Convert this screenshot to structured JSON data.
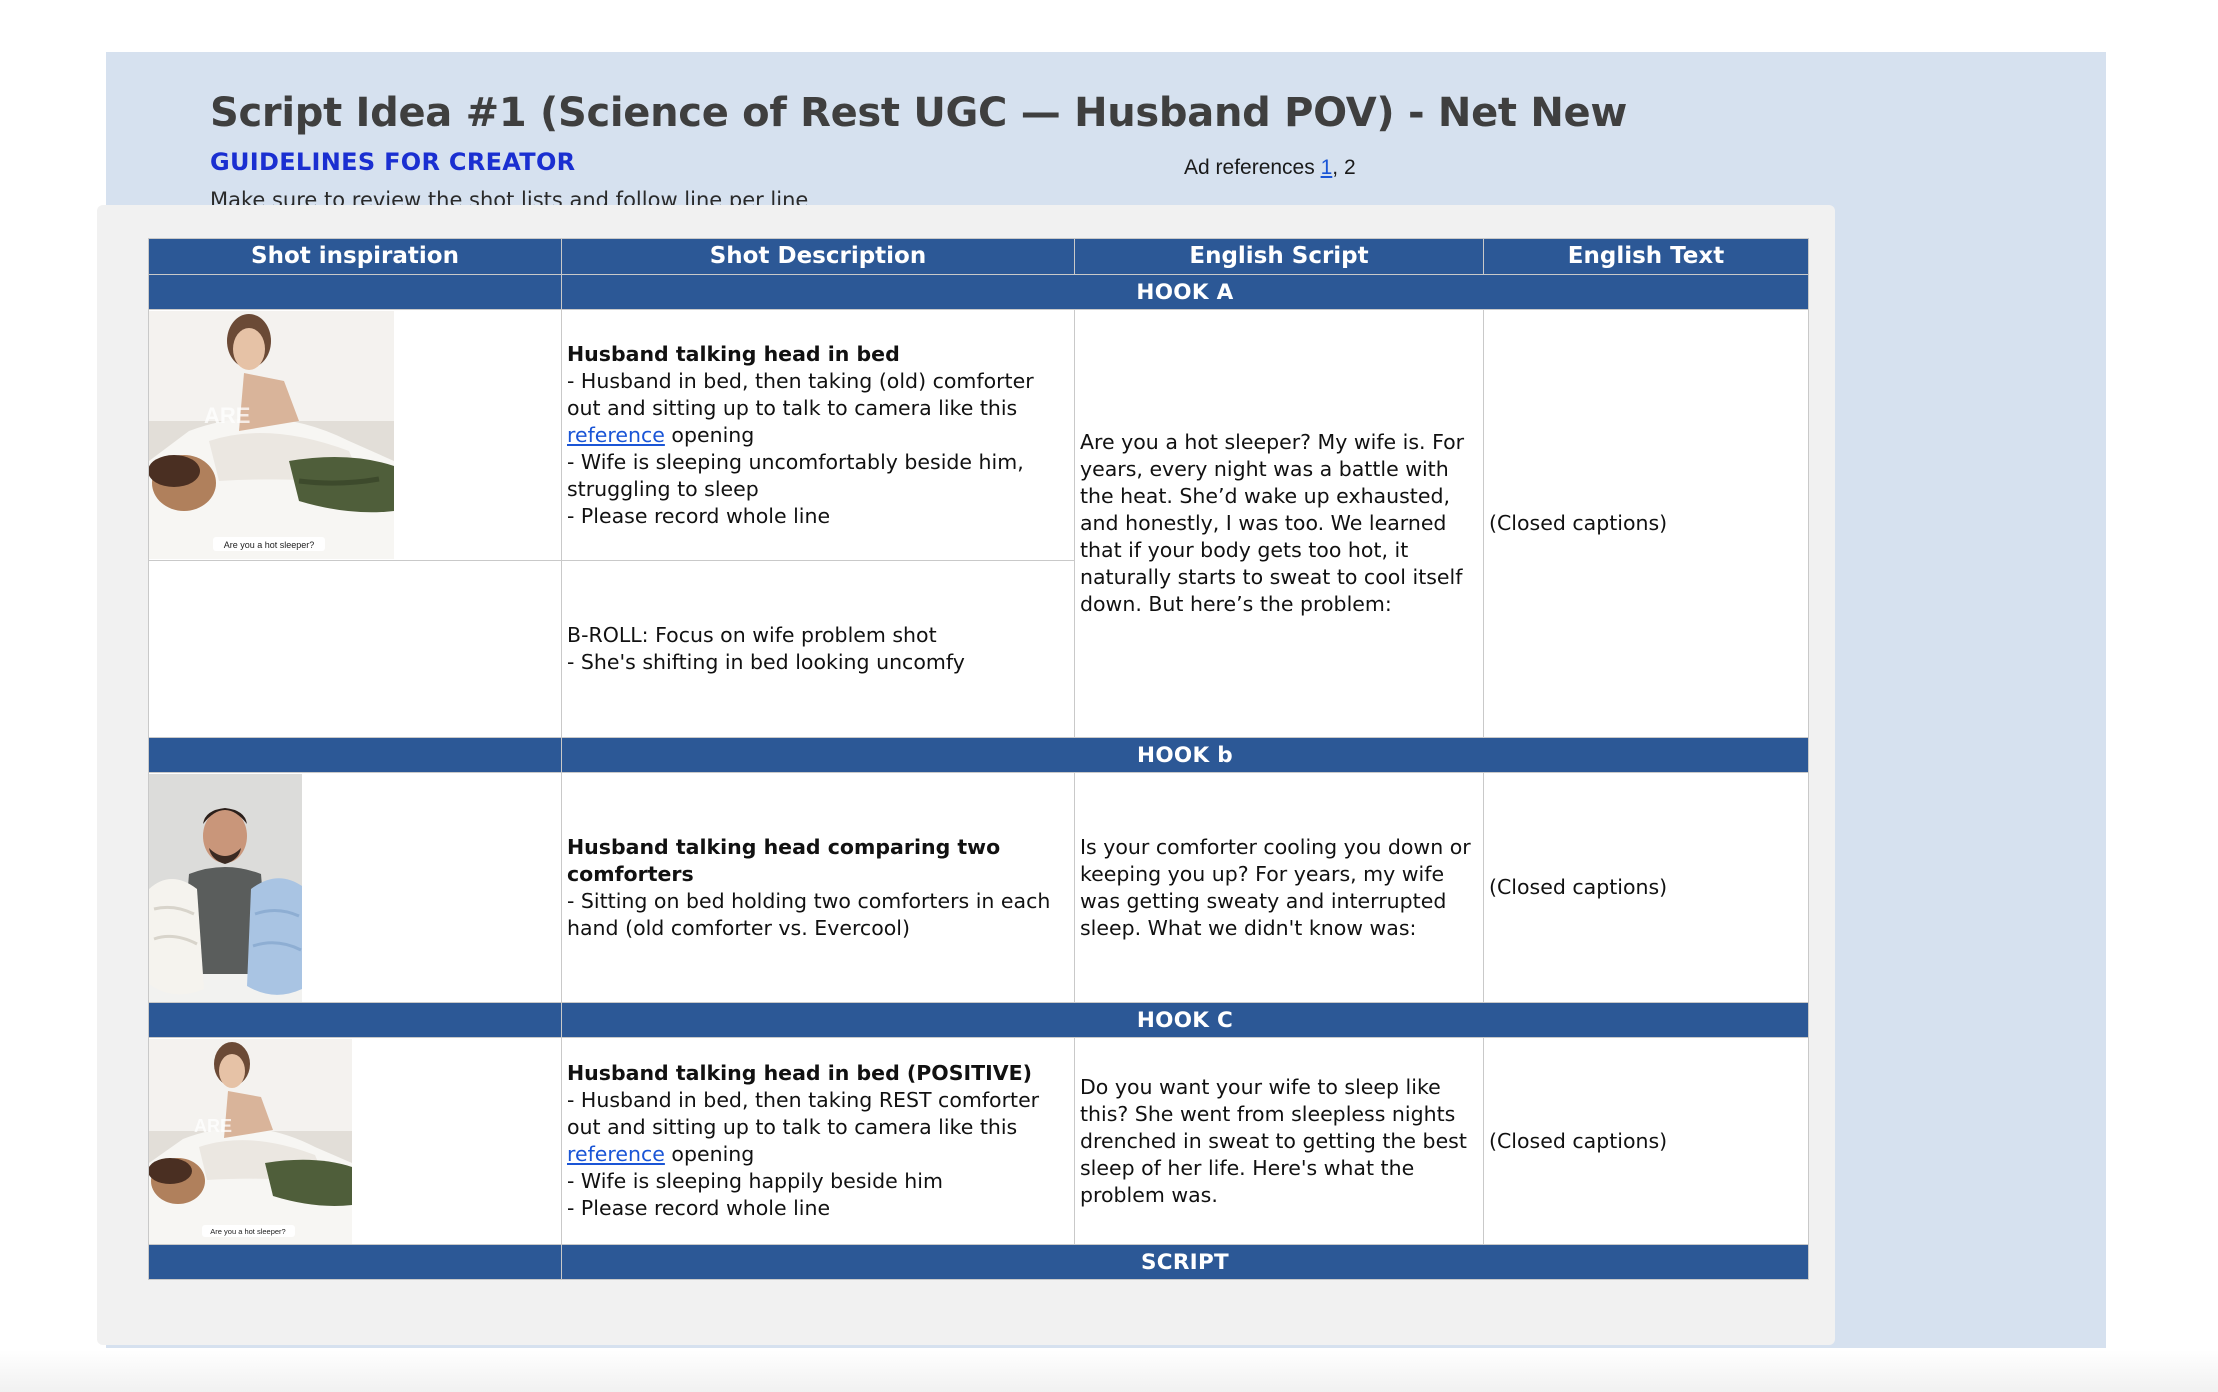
{
  "header": {
    "title": "Script Idea #1 (Science of Rest UGC — Husband POV) - Net New",
    "guidelines": "GUIDELINES FOR CREATOR",
    "instruction": "Make sure to review the shot lists and follow line per line",
    "ad_references_label": "Ad references",
    "ad_ref_1": "1",
    "ad_ref_sep": ", ",
    "ad_ref_2": "2"
  },
  "table": {
    "columns": [
      "Shot inspiration",
      "Shot Description",
      "English Script",
      "English Text"
    ],
    "sections": {
      "hook_a": {
        "title": "HOOK A",
        "thumb_word": "ARE",
        "thumb_caption": "Are you a hot sleeper?",
        "shot1_title": "Husband talking head in bed",
        "shot1_line1": "- Husband in bed, then taking (old) comforter out and sitting up to talk to camera like this",
        "shot1_link": "reference",
        "shot1_link_after": " opening",
        "shot1_line2": "- Wife is sleeping uncomfortably beside him, struggling to sleep",
        "shot1_line3": "- Please record whole line",
        "shot2_line1": "B-ROLL: Focus on wife problem shot",
        "shot2_line2": "- She's shifting in bed looking uncomfy",
        "script": "Are you a hot sleeper? My wife is. For years, every night was a battle with the heat. She’d wake up exhausted, and honestly, I was too. We learned that if your body gets too hot, it naturally starts to sweat to cool itself down. But here’s the problem:",
        "text": "(Closed captions)"
      },
      "hook_b": {
        "title": "HOOK b",
        "shot_title": "Husband talking head comparing two comforters",
        "shot_line1": "- Sitting on bed holding two comforters in each hand (old comforter vs. Evercool)",
        "script": "Is your comforter cooling you down or keeping you up? For years, my wife was getting sweaty and interrupted sleep. What we didn't know was:",
        "text": "(Closed captions)"
      },
      "hook_c": {
        "title": "HOOK C",
        "thumb_word": "ARE",
        "thumb_caption": "Are you a hot sleeper?",
        "shot_title": "Husband talking head in bed (POSITIVE)",
        "shot_line1": "- Husband in bed, then taking REST comforter out and sitting up to talk to camera like this",
        "shot_link": "reference",
        "shot_link_after": " opening",
        "shot_line2": "- Wife is sleeping happily beside him",
        "shot_line3": "- Please record whole line",
        "script": "Do you want your wife to sleep like this? She went from sleepless nights drenched in sweat to getting the best sleep of her life. Here's what the problem was.",
        "text": "(Closed captions)"
      },
      "script": {
        "title": "SCRIPT"
      }
    }
  },
  "colors": {
    "page_bg": "#d6e1ef",
    "header_blue": "#2c5896",
    "guidelines_blue": "#1a2fd1",
    "link_blue": "#1a55d6"
  }
}
